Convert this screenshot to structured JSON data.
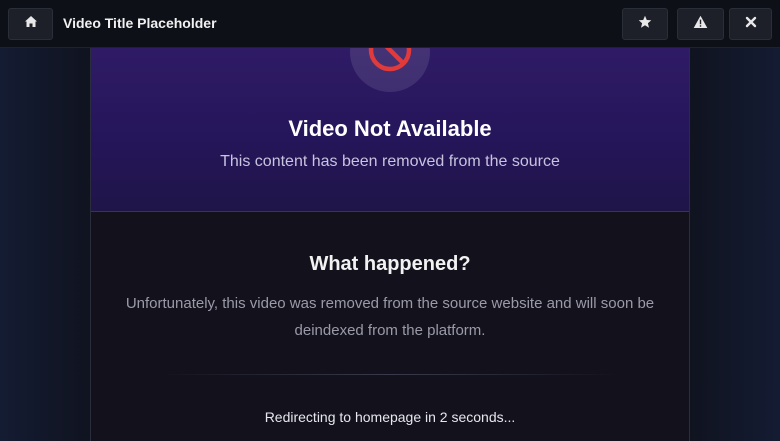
{
  "header": {
    "title": "Video Title Placeholder",
    "icons": {
      "home": "home-icon",
      "favorite": "star-icon",
      "report": "warning-icon",
      "close": "close-icon"
    }
  },
  "notice": {
    "icon": "ban-icon",
    "title": "Video Not Available",
    "subtitle": "This content has been removed from the source"
  },
  "details": {
    "heading": "What happened?",
    "message": "Unfortunately, this video was removed from the source website and will soon be deindexed from the platform.",
    "redirect_text": "Redirecting to homepage in 2 seconds..."
  },
  "colors": {
    "topbar": "#0d1016",
    "header_gradient_top": "#2f1b66",
    "header_gradient_bottom": "#1f1548",
    "ban_icon": "#e03a3a"
  }
}
